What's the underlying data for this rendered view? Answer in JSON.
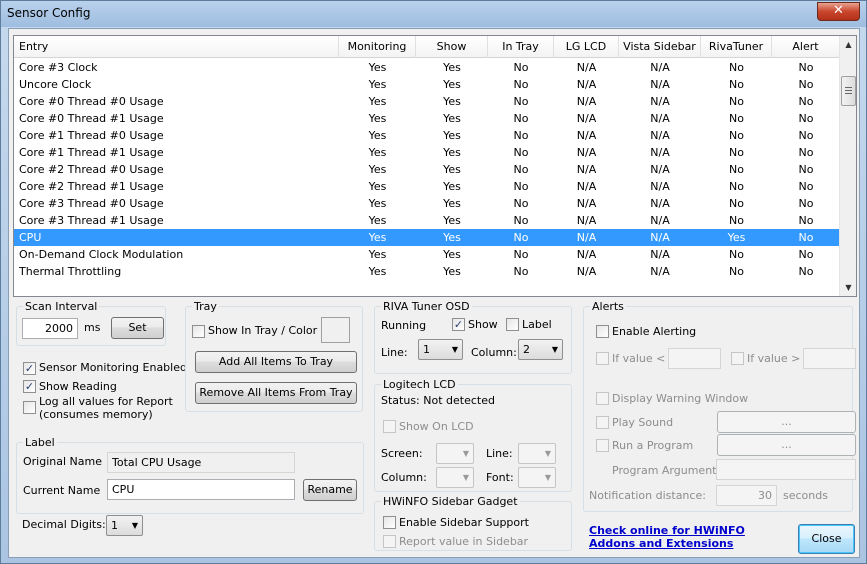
{
  "window": {
    "title": "Sensor Config",
    "close_glyph": "✕"
  },
  "table": {
    "columns": [
      "Entry",
      "Monitoring",
      "Show",
      "In Tray",
      "LG LCD",
      "Vista Sidebar",
      "RivaTuner",
      "Alert"
    ],
    "rows": [
      [
        "Core #3 Clock",
        "Yes",
        "Yes",
        "No",
        "N/A",
        "N/A",
        "No",
        "No"
      ],
      [
        "Uncore Clock",
        "Yes",
        "Yes",
        "No",
        "N/A",
        "N/A",
        "No",
        "No"
      ],
      [
        "Core #0 Thread #0 Usage",
        "Yes",
        "Yes",
        "No",
        "N/A",
        "N/A",
        "No",
        "No"
      ],
      [
        "Core #0 Thread #1 Usage",
        "Yes",
        "Yes",
        "No",
        "N/A",
        "N/A",
        "No",
        "No"
      ],
      [
        "Core #1 Thread #0 Usage",
        "Yes",
        "Yes",
        "No",
        "N/A",
        "N/A",
        "No",
        "No"
      ],
      [
        "Core #1 Thread #1 Usage",
        "Yes",
        "Yes",
        "No",
        "N/A",
        "N/A",
        "No",
        "No"
      ],
      [
        "Core #2 Thread #0 Usage",
        "Yes",
        "Yes",
        "No",
        "N/A",
        "N/A",
        "No",
        "No"
      ],
      [
        "Core #2 Thread #1 Usage",
        "Yes",
        "Yes",
        "No",
        "N/A",
        "N/A",
        "No",
        "No"
      ],
      [
        "Core #3 Thread #0 Usage",
        "Yes",
        "Yes",
        "No",
        "N/A",
        "N/A",
        "No",
        "No"
      ],
      [
        "Core #3 Thread #1 Usage",
        "Yes",
        "Yes",
        "No",
        "N/A",
        "N/A",
        "No",
        "No"
      ],
      [
        "CPU",
        "Yes",
        "Yes",
        "No",
        "N/A",
        "N/A",
        "Yes",
        "No"
      ],
      [
        "On-Demand Clock Modulation",
        "Yes",
        "Yes",
        "No",
        "N/A",
        "N/A",
        "No",
        "No"
      ],
      [
        "Thermal Throttling",
        "Yes",
        "Yes",
        "No",
        "N/A",
        "N/A",
        "No",
        "No"
      ]
    ],
    "selected_index": 10
  },
  "scan": {
    "label": "Scan Interval",
    "value": "2000",
    "unit": "ms",
    "set_label": "Set"
  },
  "options": {
    "sensor_monitoring": "Sensor Monitoring Enabled",
    "show_reading": "Show Reading",
    "log_all_1": "Log all values for Report",
    "log_all_2": "(consumes memory)",
    "check": "✓"
  },
  "tray": {
    "label": "Tray",
    "show_in_tray": "Show In Tray / Color",
    "add_all": "Add All Items To Tray",
    "remove_all": "Remove All Items From Tray"
  },
  "label_group": {
    "label": "Label",
    "original_name_label": "Original Name",
    "original_name": "Total CPU Usage",
    "current_name_label": "Current Name",
    "current_name": "CPU",
    "rename": "Rename"
  },
  "decimal": {
    "label": "Decimal Digits:",
    "value": "1"
  },
  "riva": {
    "label": "RIVA Tuner OSD",
    "running": "Running",
    "show": "Show",
    "label_cb": "Label",
    "line_label": "Line:",
    "line_value": "1",
    "column_label": "Column:",
    "column_value": "2"
  },
  "lcd": {
    "label": "Logitech LCD",
    "status": "Status: Not detected",
    "show_on_lcd": "Show On LCD",
    "screen": "Screen:",
    "line": "Line:",
    "column": "Column:",
    "font": "Font:"
  },
  "gadget": {
    "label": "HWiNFO Sidebar Gadget",
    "enable": "Enable Sidebar Support",
    "report": "Report value in Sidebar"
  },
  "alerts": {
    "label": "Alerts",
    "enable": "Enable Alerting",
    "if_less": "If value <",
    "if_greater": "If value >",
    "display_warning": "Display Warning Window",
    "play_sound": "Play Sound",
    "run_program": "Run a Program",
    "browse": "...",
    "program_args": "Program Arguments:",
    "notif_label": "Notification distance:",
    "notif_value": "30",
    "notif_unit": "seconds"
  },
  "footer": {
    "link_1": "Check online for HWiNFO",
    "link_2": "Addons and Extensions",
    "close": "Close"
  }
}
